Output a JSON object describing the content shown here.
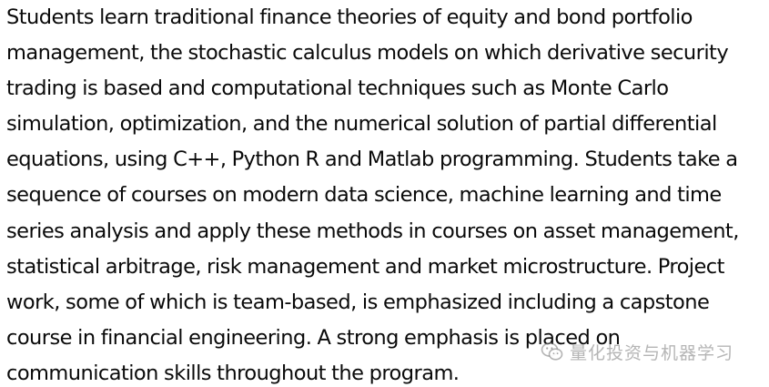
{
  "document": {
    "paragraph_lines": [
      "Students learn traditional finance theories of equity and bond portfolio",
      "management, the stochastic calculus models on which derivative security",
      "trading is based and computational techniques such as Monte Carlo",
      "simulation, optimization, and the numerical solution of partial differential",
      "equations, using C++, Python R and Matlab programming. Students take a",
      "sequence of courses on modern data science, machine learning and time",
      "series analysis and apply these methods in courses on asset management,",
      "statistical arbitrage, risk management and market microstructure. Project",
      "work, some of which is team-based, is emphasized including a capstone",
      "course in financial engineering. A strong emphasis is placed on",
      "communication skills throughout the program."
    ]
  },
  "watermark": {
    "icon": "wechat-icon",
    "text": "量化投资与机器学习",
    "color": "#8a8a8a"
  }
}
